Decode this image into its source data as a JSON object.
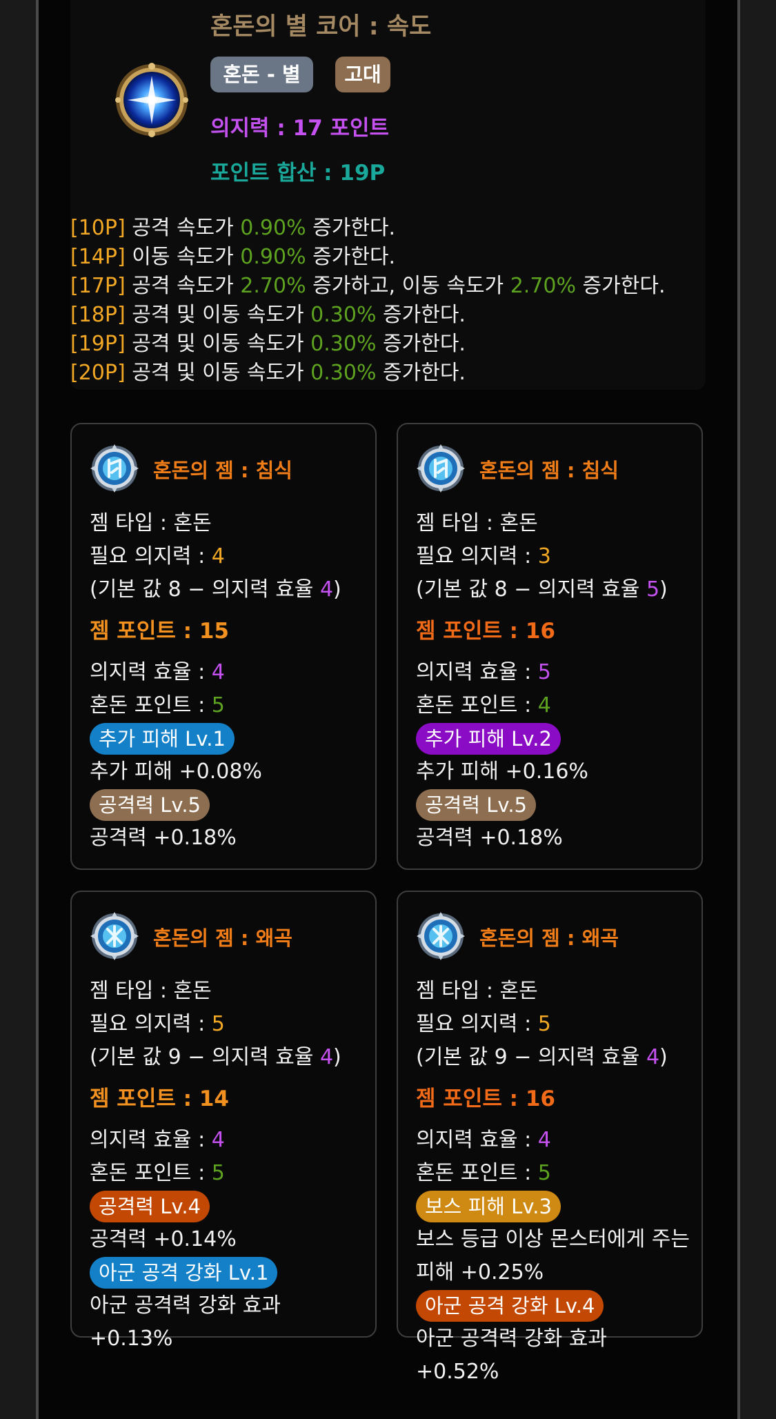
{
  "core": {
    "title": "혼돈의 별 코어 : 속도",
    "icon": "chaos-star-core-icon",
    "badge_type": "혼돈 - 별",
    "badge_grade": "고대",
    "willpower": "의지력 : 17 포인트",
    "point_sum": "포인트 합산 : 19P",
    "effects": [
      {
        "p": "[10P]",
        "a": " 공격 속도가 ",
        "v1": "0.90%",
        "b": " 증가한다.",
        "v2": "",
        "c": ""
      },
      {
        "p": "[14P]",
        "a": " 이동 속도가 ",
        "v1": "0.90%",
        "b": " 증가한다.",
        "v2": "",
        "c": ""
      },
      {
        "p": "[17P]",
        "a": " 공격 속도가 ",
        "v1": "2.70%",
        "b": " 증가하고, 이동 속도가 ",
        "v2": "2.70%",
        "c": " 증가한다."
      },
      {
        "p": "[18P]",
        "a": " 공격 및 이동 속도가 ",
        "v1": "0.30%",
        "b": " 증가한다.",
        "v2": "",
        "c": ""
      },
      {
        "p": "[19P]",
        "a": " 공격 및 이동 속도가 ",
        "v1": "0.30%",
        "b": " 증가한다.",
        "v2": "",
        "c": ""
      },
      {
        "p": "[20P]",
        "a": " 공격 및 이동 속도가 ",
        "v1": "0.30%",
        "b": " 증가한다.",
        "v2": "",
        "c": ""
      }
    ]
  },
  "gems": [
    {
      "name": "혼돈의 젬 : 침식",
      "icon": "erosion-gem-icon",
      "type_line": "젬 타입 : 혼돈",
      "req_label": "필요 의지력 : ",
      "req_value": "4",
      "base_a": "(기본 값 8 − 의지력 효율 ",
      "base_value": "4",
      "base_b": ")",
      "gem_points": "젬 포인트 : 15",
      "gem_points_color": "#f29120",
      "eff_label": "의지력 효율 : ",
      "eff_value": "4",
      "chaos_label": "혼돈 포인트 : ",
      "chaos_value": "5",
      "opt1_badge": "추가 피해 Lv.1",
      "opt1_color": "#1480c8",
      "opt1_text": "추가 피해 +0.08%",
      "opt2_badge": "공격력 Lv.5",
      "opt2_color": "#8d6e50",
      "opt2_text": "공격력 +0.18%"
    },
    {
      "name": "혼돈의 젬 : 침식",
      "icon": "erosion-gem-icon",
      "type_line": "젬 타입 : 혼돈",
      "req_label": "필요 의지력 : ",
      "req_value": "3",
      "base_a": "(기본 값 8 − 의지력 효율 ",
      "base_value": "5",
      "base_b": ")",
      "gem_points": "젬 포인트 : 16",
      "gem_points_color": "#f06a18",
      "eff_label": "의지력 효율 : ",
      "eff_value": "5",
      "chaos_label": "혼돈 포인트 : ",
      "chaos_value": "4",
      "opt1_badge": "추가 피해 Lv.2",
      "opt1_color": "#8a0cc4",
      "opt1_text": "추가 피해 +0.16%",
      "opt2_badge": "공격력 Lv.5",
      "opt2_color": "#8d6e50",
      "opt2_text": "공격력 +0.18%"
    },
    {
      "name": "혼돈의 젬 : 왜곡",
      "icon": "distortion-gem-icon",
      "type_line": "젬 타입 : 혼돈",
      "req_label": "필요 의지력 : ",
      "req_value": "5",
      "base_a": "(기본 값 9 − 의지력 효율 ",
      "base_value": "4",
      "base_b": ")",
      "gem_points": "젬 포인트 : 14",
      "gem_points_color": "#f29120",
      "eff_label": "의지력 효율 : ",
      "eff_value": "4",
      "chaos_label": "혼돈 포인트 : ",
      "chaos_value": "5",
      "opt1_badge": "공격력 Lv.4",
      "opt1_color": "#c24804",
      "opt1_text": "공격력 +0.14%",
      "opt2_badge": "아군 공격 강화 Lv.1",
      "opt2_color": "#1480c8",
      "opt2_text": "아군 공격력 강화 효과 +0.13%"
    },
    {
      "name": "혼돈의 젬 : 왜곡",
      "icon": "distortion-gem-icon",
      "type_line": "젬 타입 : 혼돈",
      "req_label": "필요 의지력 : ",
      "req_value": "5",
      "base_a": "(기본 값 9 − 의지력 효율 ",
      "base_value": "4",
      "base_b": ")",
      "gem_points": "젬 포인트 : 16",
      "gem_points_color": "#f06a18",
      "eff_label": "의지력 효율 : ",
      "eff_value": "4",
      "chaos_label": "혼돈 포인트 : ",
      "chaos_value": "5",
      "opt1_badge": "보스 피해 Lv.3",
      "opt1_color": "#ce8a12",
      "opt1_text": "보스 등급 이상 몬스터에게 주는 피해 +0.25%",
      "opt2_badge": "아군 공격 강화 Lv.4",
      "opt2_color": "#c24804",
      "opt2_text": "아군 공격력 강화 효과 +0.52%"
    }
  ]
}
